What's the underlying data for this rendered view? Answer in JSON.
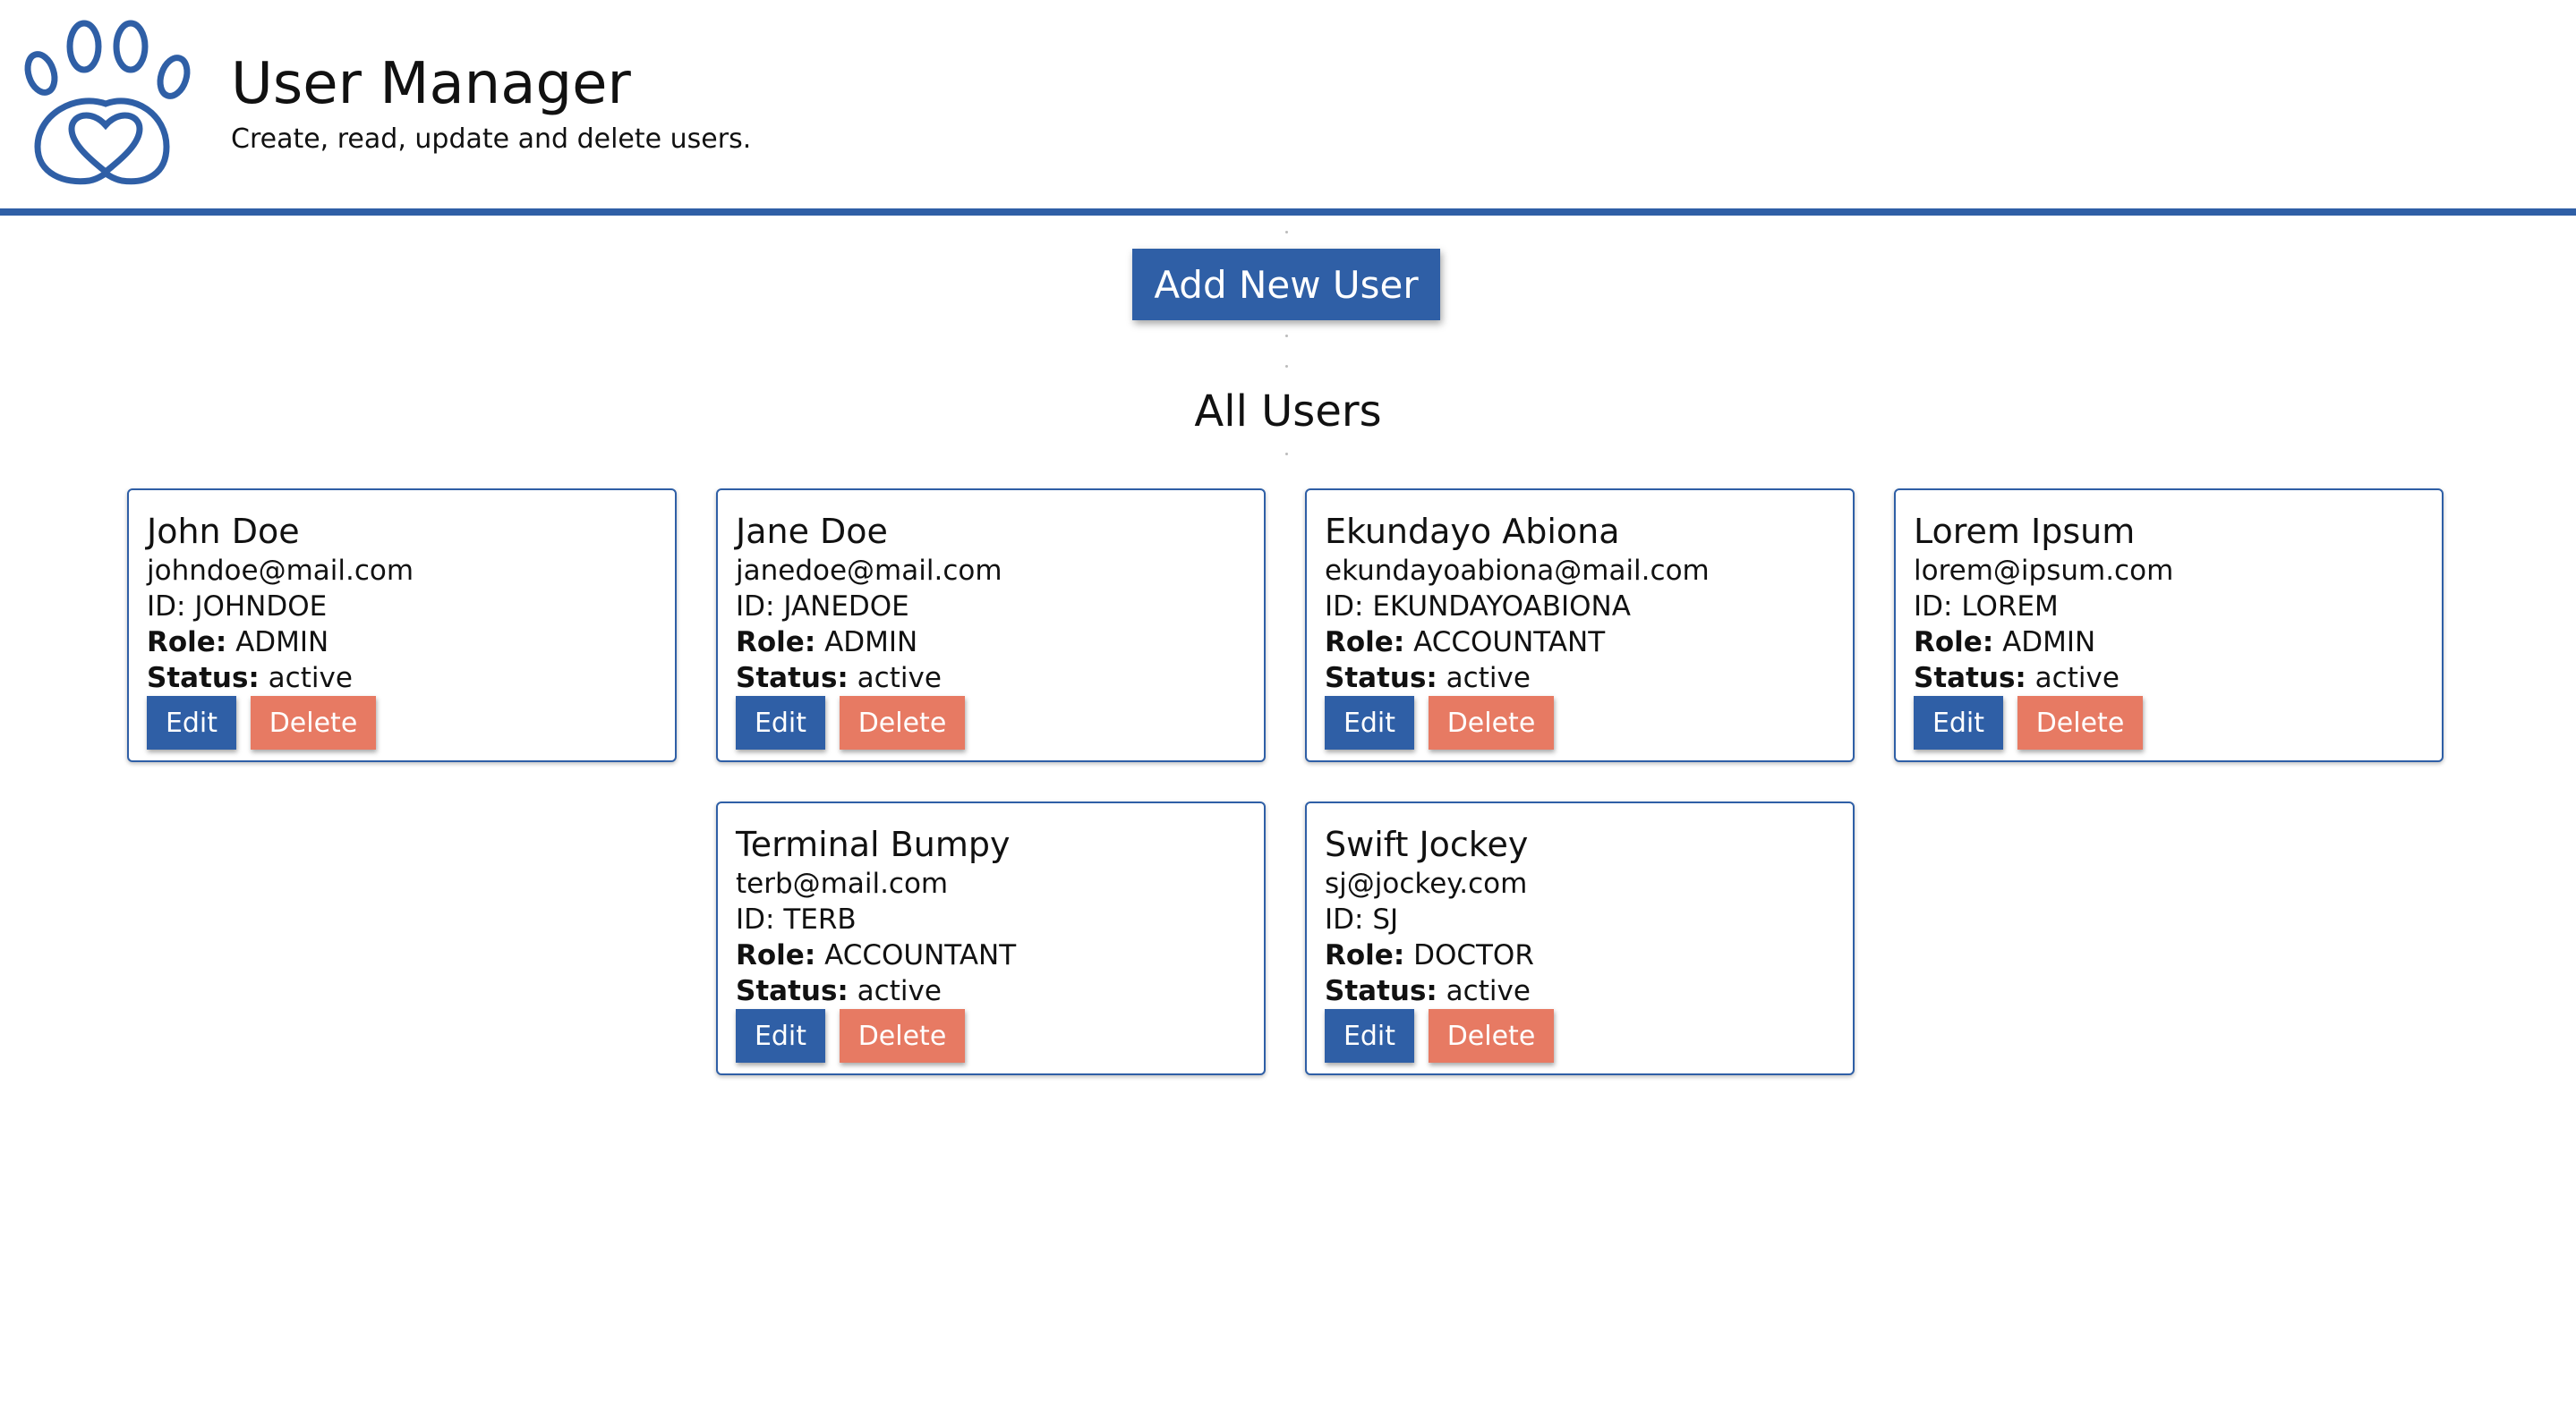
{
  "header": {
    "title": "User Manager",
    "subtitle": "Create, read, update and delete users.",
    "logo_icon": "paw-heart-icon"
  },
  "colors": {
    "primary": "#2f5fa6",
    "danger": "#e77a63",
    "text": "#111111",
    "background": "#ffffff"
  },
  "actions": {
    "add_user_label": "Add New User"
  },
  "users_section": {
    "title": "All Users",
    "labels": {
      "id": "ID:",
      "role": "Role:",
      "status": "Status:"
    },
    "edit_label": "Edit",
    "delete_label": "Delete",
    "users": [
      {
        "name": "John Doe",
        "email": "johndoe@mail.com",
        "id": "JOHNDOE",
        "role": "ADMIN",
        "status": "active"
      },
      {
        "name": "Jane Doe",
        "email": "janedoe@mail.com",
        "id": "JANEDOE",
        "role": "ADMIN",
        "status": "active"
      },
      {
        "name": "Ekundayo Abiona",
        "email": "ekundayoabiona@mail.com",
        "id": "EKUNDAYOABIONA",
        "role": "ACCOUNTANT",
        "status": "active"
      },
      {
        "name": "Lorem Ipsum",
        "email": "lorem@ipsum.com",
        "id": "LOREM",
        "role": "ADMIN",
        "status": "active"
      },
      {
        "name": "Terminal Bumpy",
        "email": "terb@mail.com",
        "id": "TERB",
        "role": "ACCOUNTANT",
        "status": "active"
      },
      {
        "name": "Swift Jockey",
        "email": "sj@jockey.com",
        "id": "SJ",
        "role": "DOCTOR",
        "status": "active"
      }
    ]
  }
}
